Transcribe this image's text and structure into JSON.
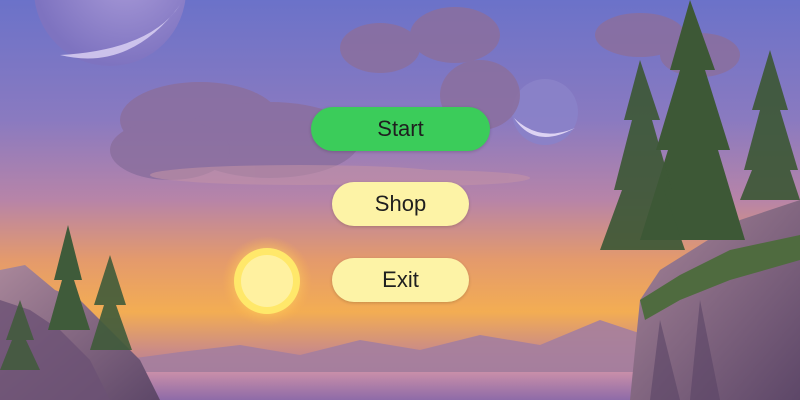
{
  "menu": {
    "start_label": "Start",
    "shop_label": "Shop",
    "exit_label": "Exit"
  },
  "colors": {
    "start_button": "#3bcc5a",
    "secondary_button": "#fdf3a6",
    "button_text": "#1f1f1f",
    "sky_top": "#6d72c9",
    "sky_horizon": "#f2a24e"
  },
  "icons": [
    "large-moon-icon",
    "small-moon-icon",
    "sun-icon",
    "pine-tree-icon"
  ]
}
